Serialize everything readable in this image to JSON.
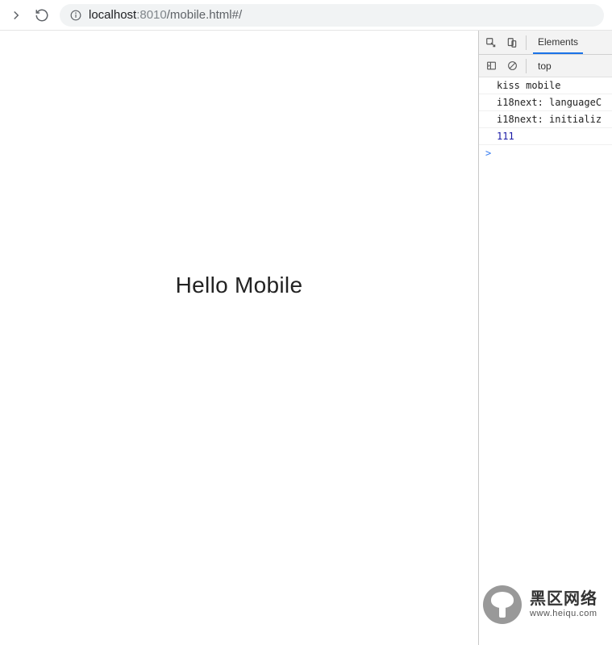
{
  "address_bar": {
    "url_host": "localhost",
    "url_port": ":8010",
    "url_path": "/mobile.html#/"
  },
  "page": {
    "heading": "Hello Mobile"
  },
  "devtools": {
    "tabs": {
      "elements": "Elements"
    },
    "console": {
      "context": "top",
      "messages": [
        {
          "text": "kiss mobile",
          "type": "log"
        },
        {
          "text": "i18next: languageC",
          "type": "log"
        },
        {
          "text": "i18next: initializ",
          "type": "log"
        },
        {
          "text": "111",
          "type": "num"
        }
      ],
      "prompt": ">"
    }
  },
  "watermark": {
    "title": "黑区网络",
    "subtitle": "www.heiqu.com"
  }
}
